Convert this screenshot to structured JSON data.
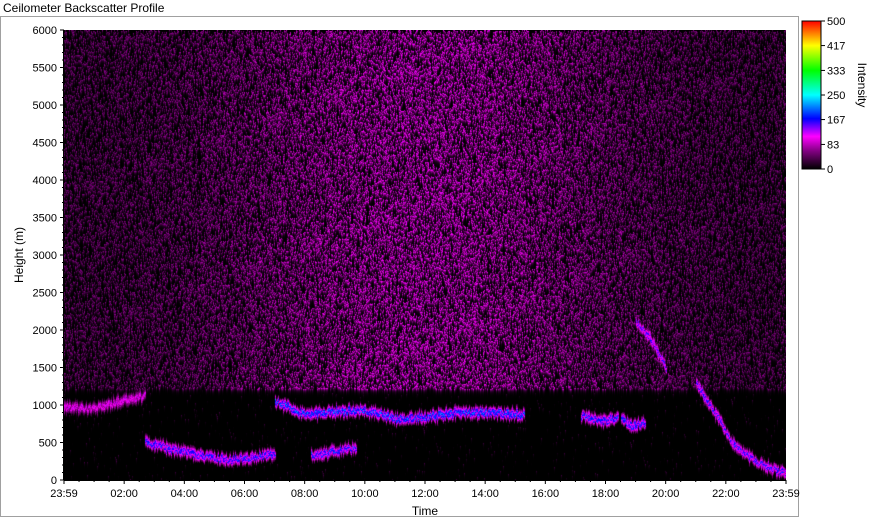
{
  "window": {
    "title": "Ceilometer Backscatter Profile"
  },
  "chart_data": {
    "type": "heatmap",
    "title": "Ceilometer Backscatter Profile",
    "xlabel": "Time",
    "ylabel": "Height (m)",
    "x_tick_labels": [
      "23:59",
      "02:00",
      "04:00",
      "06:00",
      "08:00",
      "10:00",
      "12:00",
      "14:00",
      "16:00",
      "18:00",
      "20:00",
      "22:00",
      "23:59"
    ],
    "x_tick_hours": [
      0,
      2,
      4,
      6,
      8,
      10,
      12,
      14,
      16,
      18,
      20,
      22,
      24
    ],
    "xlim_hours": [
      0,
      24
    ],
    "y_tick_labels": [
      "0",
      "500",
      "1000",
      "1500",
      "2000",
      "2500",
      "3000",
      "3500",
      "4000",
      "4500",
      "5000",
      "5500",
      "6000"
    ],
    "y_tick_values": [
      0,
      500,
      1000,
      1500,
      2000,
      2500,
      3000,
      3500,
      4000,
      4500,
      5000,
      5500,
      6000
    ],
    "ylim": [
      0,
      6000
    ],
    "colorbar": {
      "label": "Intensity",
      "tick_labels": [
        "500",
        "417",
        "333",
        "250",
        "167",
        "83",
        "0"
      ],
      "tick_values": [
        500,
        417,
        333,
        250,
        167,
        83,
        0
      ],
      "range": [
        0,
        500
      ],
      "stops": [
        {
          "v": 0,
          "color": "#000000"
        },
        {
          "v": 60,
          "color": "#800080"
        },
        {
          "v": 110,
          "color": "#ff00ff"
        },
        {
          "v": 170,
          "color": "#0000ff"
        },
        {
          "v": 250,
          "color": "#00ffff"
        },
        {
          "v": 333,
          "color": "#00ff00"
        },
        {
          "v": 417,
          "color": "#ffff00"
        },
        {
          "v": 500,
          "color": "#ff0000"
        }
      ]
    },
    "background_noise": {
      "above_height": 1200,
      "intensity": 70,
      "peak_time_hour": 12
    },
    "layers": [
      {
        "t": [
          0.0,
          1.0,
          2.0,
          2.7
        ],
        "h": [
          980,
          960,
          1080,
          1130
        ],
        "intensity": 110
      },
      {
        "t": [
          2.7,
          3.5,
          4.5,
          5.5,
          6.5,
          7.0
        ],
        "h": [
          500,
          420,
          330,
          270,
          320,
          360
        ],
        "intensity": 170
      },
      {
        "t": [
          7.0,
          8.0,
          9.0,
          10.0,
          11.0,
          12.0,
          13.0,
          14.0,
          15.3
        ],
        "h": [
          1050,
          880,
          920,
          940,
          820,
          840,
          900,
          910,
          880
        ],
        "intensity": 190
      },
      {
        "t": [
          8.2,
          9.0,
          9.7
        ],
        "h": [
          340,
          380,
          430
        ],
        "intensity": 170
      },
      {
        "t": [
          17.2,
          17.8,
          18.4
        ],
        "h": [
          870,
          780,
          830
        ],
        "intensity": 180
      },
      {
        "t": [
          18.5,
          18.9,
          19.3
        ],
        "h": [
          820,
          720,
          780
        ],
        "intensity": 180
      },
      {
        "t": [
          19.0,
          19.5,
          20.0
        ],
        "h": [
          2100,
          1900,
          1500
        ],
        "intensity": 150
      },
      {
        "t": [
          21.0,
          21.7,
          22.3,
          23.2,
          24.0
        ],
        "h": [
          1300,
          850,
          450,
          200,
          90
        ],
        "intensity": 160
      }
    ]
  }
}
